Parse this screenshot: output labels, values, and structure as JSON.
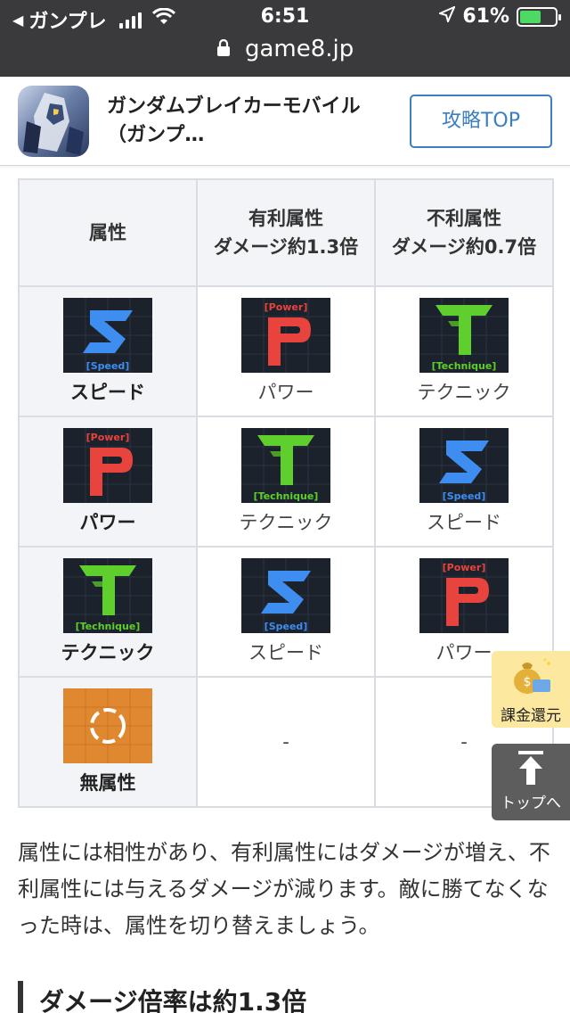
{
  "status_bar": {
    "back_app": "ガンプレ",
    "time": "6:51",
    "battery_percent": "61%",
    "battery_level": 0.61,
    "url": "game8.jp"
  },
  "app_banner": {
    "title": "ガンダムブレイカーモバイル（ガンプ…",
    "button_label": "攻略TOP"
  },
  "table": {
    "headers": [
      "属性",
      "有利属性\nダメージ約1.3倍",
      "不利属性\nダメージ約0.7倍"
    ],
    "rows": [
      {
        "attr": "スピード",
        "attr_icon": "speed-icon",
        "adv": "パワー",
        "adv_icon": "power-icon",
        "dis": "テクニック",
        "dis_icon": "technique-icon"
      },
      {
        "attr": "パワー",
        "attr_icon": "power-icon",
        "adv": "テクニック",
        "adv_icon": "technique-icon",
        "dis": "スピード",
        "dis_icon": "speed-icon"
      },
      {
        "attr": "テクニック",
        "attr_icon": "technique-icon",
        "adv": "スピード",
        "adv_icon": "speed-icon",
        "dis": "パワー",
        "dis_icon": "power-icon"
      },
      {
        "attr": "無属性",
        "attr_icon": "no-attribute-icon",
        "adv": "-",
        "dis": "-"
      }
    ],
    "badge_texts": {
      "speed": "[Speed]",
      "power": "[Power]",
      "technique": "[Technique]"
    }
  },
  "floating": {
    "kakin_label": "課金還元",
    "top_label": "トップへ"
  },
  "paragraph": "属性には相性があり、有利属性にはダメージが増え、不利属性には与えるダメージが減ります。敵に勝てなくなった時は、属性を切り替えましょう。",
  "next_heading": "ダメージ倍率は約1.3倍",
  "colors": {
    "speed": "#3d8ef0",
    "power": "#e8433c",
    "technique": "#5fcf2e",
    "no_attribute": "#e0882f",
    "link_blue": "#3b7ec3"
  }
}
